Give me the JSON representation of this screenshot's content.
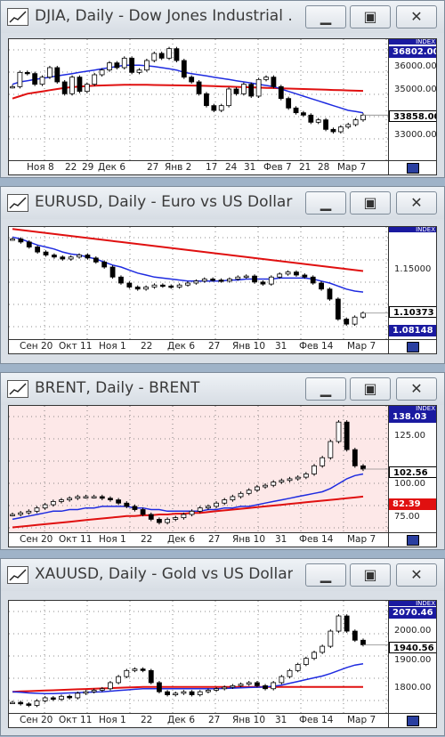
{
  "colors": {
    "accent_blue": "#1e2be0",
    "ma_red": "#e01010",
    "candle_up": "#ffffff",
    "candle_down": "#000000",
    "plot_bg_default": "#ffffff",
    "plot_bg_brent": "#fde8e8",
    "badge_blue": "#1a1aa0",
    "badge_red": "#e01010"
  },
  "windows": [
    {
      "title": "DJIA, Daily - Dow Jones Industrial ...",
      "x_labels": [
        "Ноя 8",
        "22",
        "29",
        "Дек 6",
        "27",
        "Янв 2",
        "17",
        "24",
        "31",
        "Фев 7",
        "21",
        "28",
        "Мар 7"
      ],
      "y_labels": [
        "36000.00",
        "35000.00",
        "34000.00",
        "33000.00"
      ],
      "badges": [
        {
          "text": "36802.00",
          "style": "blue"
        },
        {
          "text": "33858.00",
          "style": "black"
        }
      ],
      "index_label": "INDEX",
      "chart_data": {
        "type": "line",
        "ylim": [
          32000,
          37100
        ],
        "series": [
          {
            "values": [
              35100,
              35700,
              35650,
              35200,
              35500,
              35900,
              35300,
              34800,
              35500,
              34900,
              35200,
              35600,
              35800,
              36100,
              35900,
              36300,
              35700,
              35800,
              36200,
              36500,
              36300,
              36700,
              36200,
              35500,
              35300,
              34800,
              34300,
              34100,
              34300,
              35000,
              34800,
              35200,
              34700,
              35400,
              35500,
              35100,
              34600,
              34200,
              34000,
              33900,
              33600,
              33700,
              33300,
              33200,
              33400,
              33500,
              33700,
              33900
            ]
          },
          {
            "values": [
              35200,
              35300,
              35350,
              35400,
              35450,
              35500,
              35550,
              35600,
              35650,
              35700,
              35750,
              35800,
              35850,
              35900,
              35950,
              36000,
              36000,
              36000,
              35980,
              35950,
              35900,
              35850,
              35800,
              35700,
              35650,
              35600,
              35550,
              35500,
              35450,
              35400,
              35350,
              35300,
              35250,
              35200,
              35150,
              35100,
              35000,
              34900,
              34800,
              34700,
              34600,
              34500,
              34400,
              34300,
              34200,
              34100,
              34050,
              34000
            ]
          },
          {
            "values": [
              34600,
              34700,
              34800,
              34850,
              34900,
              34950,
              35000,
              35050,
              35080,
              35100,
              35120,
              35140,
              35150,
              35160,
              35170,
              35180,
              35180,
              35180,
              35175,
              35170,
              35165,
              35160,
              35155,
              35150,
              35145,
              35140,
              35130,
              35120,
              35110,
              35100,
              35090,
              35080,
              35070,
              35060,
              35050,
              35040,
              35030,
              35020,
              35010,
              35000,
              34990,
              34980,
              34970,
              34960,
              34950,
              34940,
              34930,
              34920
            ]
          }
        ]
      }
    },
    {
      "title": "EURUSD, Daily - Euro vs US Dollar",
      "x_labels": [
        "Сен 20",
        "Окт 11",
        "Ноя 1",
        "22",
        "Дек 6",
        "27",
        "Янв 10",
        "31",
        "Фев 14",
        "Мар 7"
      ],
      "y_labels": [
        "1.15000"
      ],
      "badges": [
        {
          "text": "1.10373",
          "style": "black"
        },
        {
          "text": "1.08148",
          "style": "blue"
        }
      ],
      "index_label": "INDEX",
      "chart_data": {
        "type": "line",
        "ylim": [
          1.078,
          1.19
        ],
        "series": [
          {
            "values": [
              1.178,
              1.175,
              1.17,
              1.165,
              1.162,
              1.16,
              1.158,
              1.16,
              1.162,
              1.159,
              1.155,
              1.15,
              1.14,
              1.134,
              1.13,
              1.128,
              1.13,
              1.132,
              1.131,
              1.13,
              1.132,
              1.134,
              1.136,
              1.138,
              1.137,
              1.136,
              1.138,
              1.14,
              1.141,
              1.135,
              1.133,
              1.14,
              1.143,
              1.145,
              1.142,
              1.14,
              1.134,
              1.128,
              1.118,
              1.098,
              1.093,
              1.1,
              1.104
            ]
          },
          {
            "values": [
              1.18,
              1.178,
              1.175,
              1.172,
              1.17,
              1.168,
              1.165,
              1.163,
              1.162,
              1.16,
              1.158,
              1.155,
              1.152,
              1.15,
              1.147,
              1.144,
              1.142,
              1.14,
              1.139,
              1.138,
              1.137,
              1.136,
              1.136,
              1.136,
              1.136,
              1.136,
              1.137,
              1.137,
              1.138,
              1.138,
              1.138,
              1.138,
              1.139,
              1.139,
              1.139,
              1.139,
              1.138,
              1.136,
              1.134,
              1.131,
              1.128,
              1.126,
              1.125
            ]
          },
          {
            "values": [
              1.188,
              1.187,
              1.186,
              1.185,
              1.184,
              1.183,
              1.182,
              1.181,
              1.18,
              1.179,
              1.178,
              1.177,
              1.176,
              1.175,
              1.174,
              1.173,
              1.172,
              1.171,
              1.17,
              1.169,
              1.168,
              1.167,
              1.166,
              1.165,
              1.164,
              1.163,
              1.162,
              1.161,
              1.16,
              1.159,
              1.158,
              1.157,
              1.156,
              1.155,
              1.154,
              1.153,
              1.152,
              1.151,
              1.15,
              1.149,
              1.148,
              1.147,
              1.146
            ]
          }
        ]
      }
    },
    {
      "title": "BRENT, Daily - BRENT",
      "x_labels": [
        "Сен 20",
        "Окт 11",
        "Ноя 1",
        "22",
        "Дек 6",
        "27",
        "Янв 10",
        "31",
        "Фев 14",
        "Мар 7"
      ],
      "y_labels": [
        "125.00",
        "100.00",
        "75.00"
      ],
      "badges": [
        {
          "text": "138.03",
          "style": "blue"
        },
        {
          "text": "102.56",
          "style": "black"
        },
        {
          "text": "82.39",
          "style": "red"
        }
      ],
      "index_label": "INDEX",
      "chart_data": {
        "type": "line",
        "ylim": [
          64,
          142
        ],
        "series": [
          {
            "values": [
              75,
              76,
              77,
              79,
              81,
              83,
              84,
              85,
              86,
              86,
              86,
              85,
              84,
              82,
              80,
              78,
              75,
              72,
              70,
              72,
              73,
              75,
              77,
              79,
              80,
              82,
              84,
              86,
              88,
              90,
              92,
              93,
              95,
              96,
              97,
              98,
              100,
              105,
              110,
              120,
              132,
              115,
              105,
              103
            ]
          },
          {
            "values": [
              72,
              73,
              74,
              75,
              76,
              77,
              77,
              78,
              78,
              79,
              79,
              80,
              80,
              80,
              80,
              79,
              79,
              78,
              78,
              77,
              77,
              77,
              77,
              77,
              78,
              78,
              79,
              79,
              80,
              80,
              81,
              82,
              83,
              84,
              85,
              86,
              87,
              88,
              89,
              91,
              94,
              97,
              99,
              100
            ]
          },
          {
            "values": [
              67,
              67.5,
              68,
              68.5,
              69,
              69.5,
              70,
              70.5,
              71,
              71.5,
              72,
              72.5,
              73,
              73.5,
              74,
              74,
              74.5,
              74.5,
              75,
              75,
              75.5,
              75.5,
              76,
              76,
              76.5,
              77,
              77.5,
              78,
              78.5,
              79,
              79.5,
              80,
              80.5,
              81,
              81.5,
              82,
              82.5,
              83,
              83.5,
              84,
              84.5,
              85,
              85.5,
              86
            ]
          }
        ]
      }
    },
    {
      "title": "XAUUSD, Daily - Gold vs US Dollar",
      "x_labels": [
        "Сен 20",
        "Окт 11",
        "Ноя 1",
        "22",
        "Дек 6",
        "27",
        "Янв 10",
        "31",
        "Фев 14",
        "Мар 7"
      ],
      "y_labels": [
        "2000.00",
        "1900.00",
        "1800.00"
      ],
      "badges": [
        {
          "text": "2070.46",
          "style": "blue"
        },
        {
          "text": "1940.56",
          "style": "black"
        }
      ],
      "index_label": "INDEX",
      "chart_data": {
        "type": "line",
        "ylim": [
          1720,
          2090
        ],
        "series": [
          {
            "values": [
              1755,
              1750,
              1745,
              1760,
              1770,
              1765,
              1775,
              1770,
              1785,
              1790,
              1795,
              1800,
              1820,
              1840,
              1860,
              1865,
              1860,
              1820,
              1790,
              1780,
              1785,
              1790,
              1780,
              1790,
              1795,
              1800,
              1805,
              1810,
              1815,
              1820,
              1810,
              1800,
              1820,
              1840,
              1860,
              1880,
              1900,
              1920,
              1940,
              1990,
              2040,
              1990,
              1960,
              1945
            ]
          },
          {
            "values": [
              1790,
              1788,
              1786,
              1785,
              1784,
              1784,
              1785,
              1786,
              1787,
              1788,
              1789,
              1790,
              1792,
              1794,
              1796,
              1798,
              1800,
              1800,
              1800,
              1800,
              1800,
              1800,
              1800,
              1800,
              1800,
              1800,
              1801,
              1802,
              1803,
              1804,
              1805,
              1806,
              1808,
              1812,
              1818,
              1824,
              1830,
              1836,
              1842,
              1850,
              1860,
              1870,
              1878,
              1882
            ]
          },
          {
            "values": [
              1790,
              1791,
              1792,
              1793,
              1794,
              1795,
              1796,
              1797,
              1798,
              1799,
              1800,
              1801,
              1802,
              1803,
              1804,
              1805,
              1806,
              1806,
              1806,
              1806,
              1806,
              1806,
              1806,
              1806,
              1806,
              1806,
              1806,
              1806,
              1806,
              1806,
              1806,
              1806,
              1806,
              1806,
              1806,
              1806,
              1806,
              1806,
              1806,
              1806,
              1806,
              1806,
              1806,
              1806
            ]
          }
        ]
      }
    }
  ]
}
